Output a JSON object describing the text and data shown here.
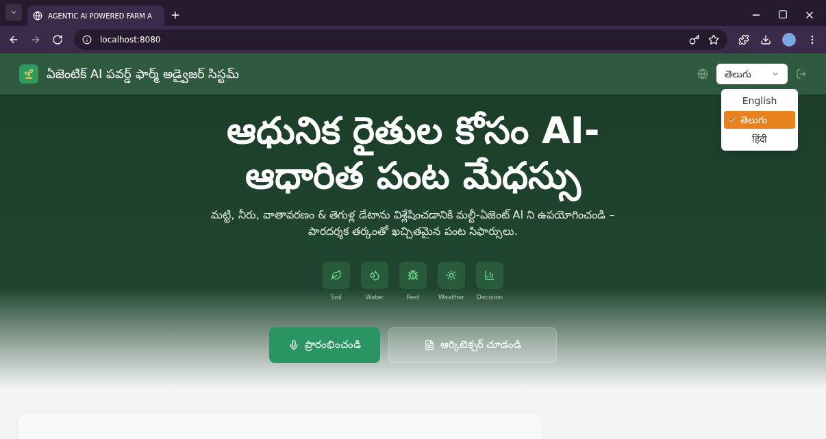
{
  "browser": {
    "tab_title": "AGENTIC AI POWERED FARM A",
    "url": "localhost:8080"
  },
  "header": {
    "title": "ఏజెంటిక్ AI పవర్డ్ ఫార్మ్ అడ్వైజర్ సిస్టమ్",
    "language_select": {
      "value": "తెలుగు",
      "expanded": true,
      "options": [
        {
          "label": "English",
          "selected": false
        },
        {
          "label": "తెలుగు",
          "selected": true
        },
        {
          "label": "हिंदी",
          "selected": false
        }
      ]
    }
  },
  "hero": {
    "title_lines": [
      "ఆధునిక రైతుల కోసం AI-",
      "ఆధారిత పంట మేధస్సు"
    ],
    "subtitle": "మట్టి, నీరు, వాతావరణం & తెగుళ్ల డేటాను విశ్లేషించడానికి మల్టీ-ఏజెంట్ AI ని ఉపయోగించండి – పారదర్శక తర్కంతో ఖచ్చితమైన పంట సిఫార్సులు.",
    "agents": [
      {
        "kind": "soil",
        "label": "Soil"
      },
      {
        "kind": "water",
        "label": "Water"
      },
      {
        "kind": "pest",
        "label": "Pest"
      },
      {
        "kind": "weather",
        "label": "Weather"
      },
      {
        "kind": "decision",
        "label": "Decision"
      }
    ],
    "buttons": [
      {
        "kind": "primary",
        "label": "ప్రారంభించండి"
      },
      {
        "kind": "secondary",
        "label": "ఆర్కిటెక్చర్ చూడండి"
      }
    ]
  }
}
